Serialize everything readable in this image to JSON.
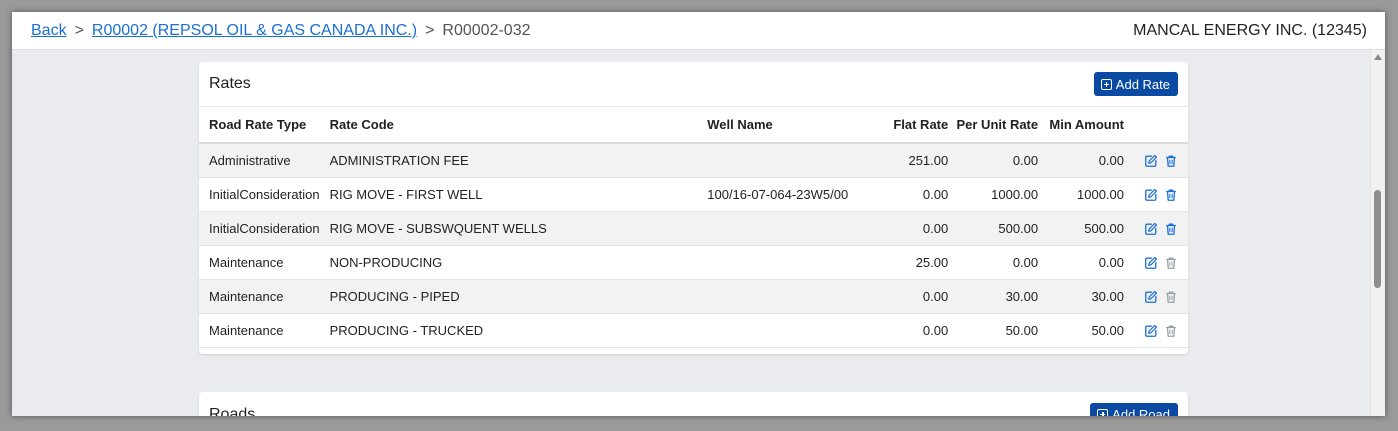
{
  "breadcrumb": {
    "back": "Back",
    "parent": "R00002 (REPSOL OIL & GAS CANADA INC.)",
    "current": "R00002-032",
    "separator": ">"
  },
  "company": "MANCAL ENERGY INC. (12345)",
  "rates": {
    "title": "Rates",
    "add_label": "Add Rate",
    "columns": [
      "Road Rate Type",
      "Rate Code",
      "Well Name",
      "Flat Rate",
      "Per Unit Rate",
      "Min Amount"
    ],
    "rows": [
      {
        "type": "Administrative",
        "code": "ADMINISTRATION FEE",
        "well": "",
        "flat": "251.00",
        "per_unit": "0.00",
        "min": "0.00",
        "delete_enabled": true
      },
      {
        "type": "InitialConsideration",
        "code": "RIG MOVE - FIRST WELL",
        "well": "100/16-07-064-23W5/00",
        "flat": "0.00",
        "per_unit": "1000.00",
        "min": "1000.00",
        "delete_enabled": true
      },
      {
        "type": "InitialConsideration",
        "code": "RIG MOVE - SUBSWQUENT WELLS",
        "well": "",
        "flat": "0.00",
        "per_unit": "500.00",
        "min": "500.00",
        "delete_enabled": true
      },
      {
        "type": "Maintenance",
        "code": "NON-PRODUCING",
        "well": "",
        "flat": "25.00",
        "per_unit": "0.00",
        "min": "0.00",
        "delete_enabled": false
      },
      {
        "type": "Maintenance",
        "code": "PRODUCING - PIPED",
        "well": "",
        "flat": "0.00",
        "per_unit": "30.00",
        "min": "30.00",
        "delete_enabled": false
      },
      {
        "type": "Maintenance",
        "code": "PRODUCING - TRUCKED",
        "well": "",
        "flat": "0.00",
        "per_unit": "50.00",
        "min": "50.00",
        "delete_enabled": false
      }
    ]
  },
  "roads": {
    "title": "Roads",
    "add_label": "Add Road"
  },
  "colors": {
    "link": "#1a6fd6",
    "primary_button": "#0b4aa2",
    "icon_active": "#1a6fd6",
    "icon_disabled": "#9aa0a6"
  }
}
